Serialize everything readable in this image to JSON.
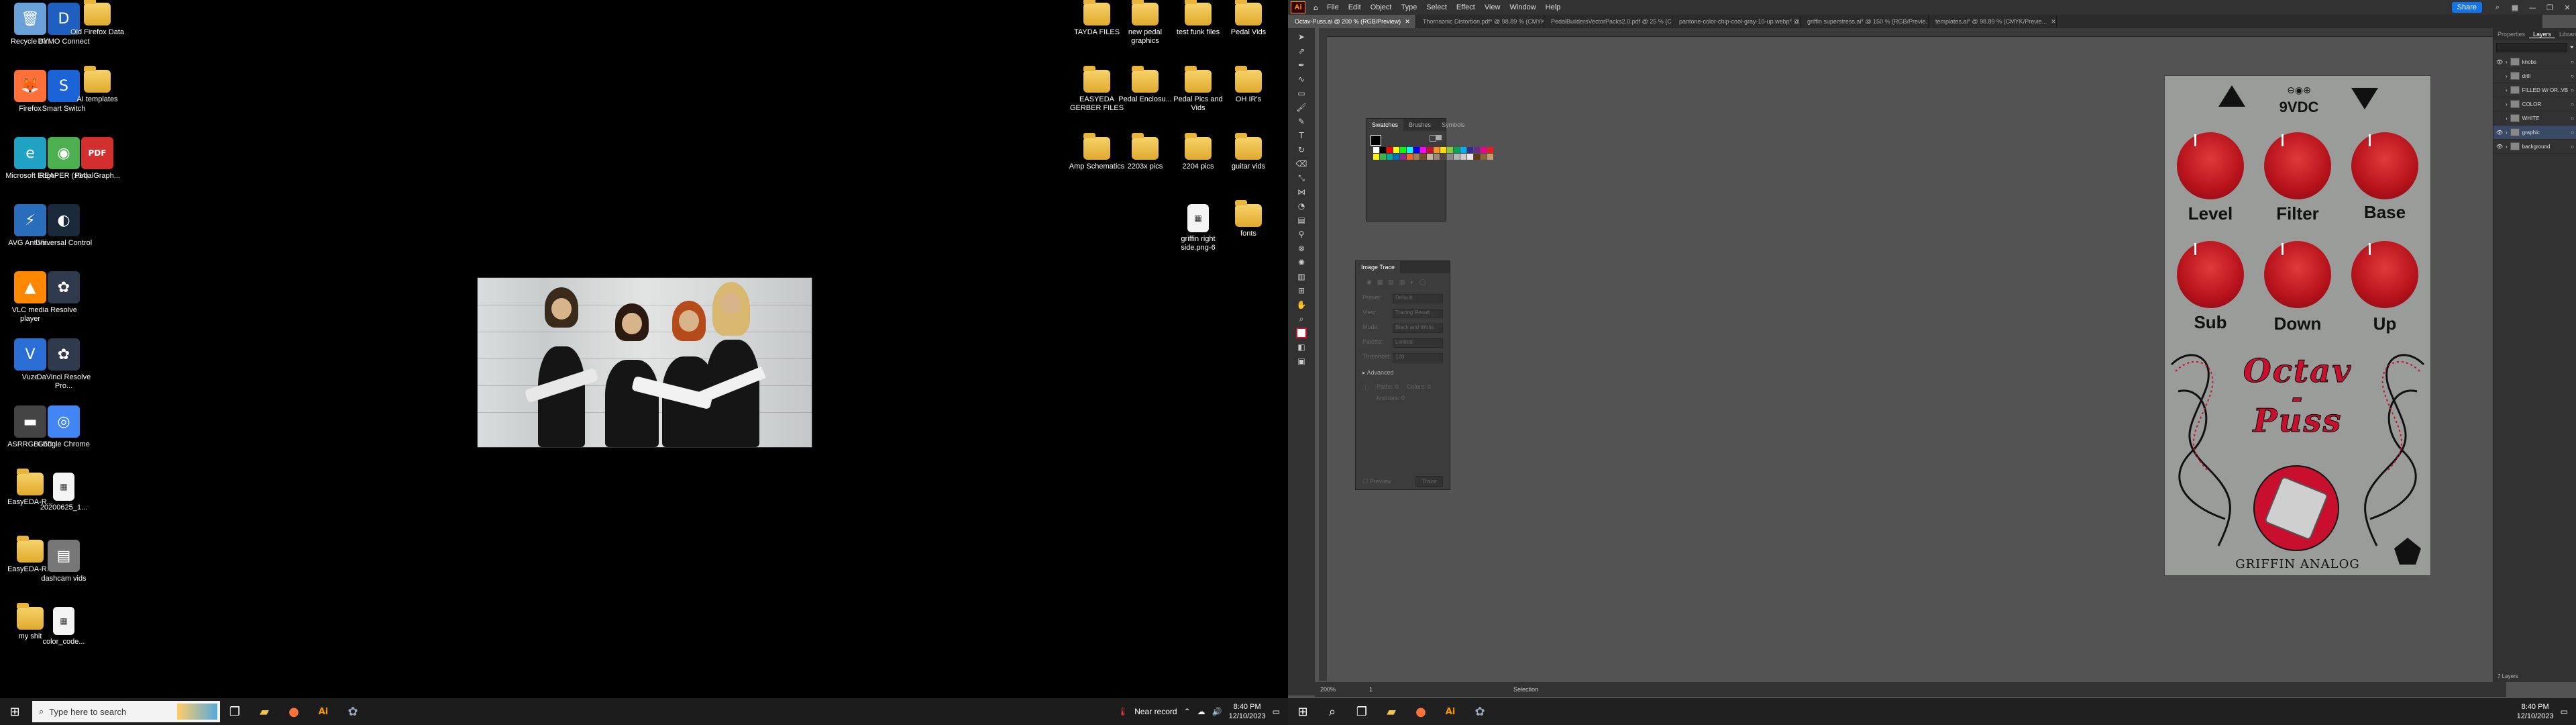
{
  "desktop": {
    "icons_col1": [
      {
        "label": "Recycle Bin",
        "icon": "recycle-bin-icon",
        "color": "#6aa0d8",
        "glyph": "🗑"
      },
      {
        "label": "Firefox",
        "icon": "firefox-icon",
        "color": "#ff7139",
        "glyph": "🦊"
      },
      {
        "label": "Microsoft Edge",
        "icon": "edge-icon",
        "color": "#1fa2c4",
        "glyph": "e"
      },
      {
        "label": "AVG AntiVir...",
        "icon": "avg-icon",
        "color": "#2a6ebb",
        "glyph": "⚡"
      },
      {
        "label": "VLC media player",
        "icon": "vlc-icon",
        "color": "#ff8800",
        "glyph": "▲"
      },
      {
        "label": "Vuze",
        "icon": "vuze-icon",
        "color": "#2b6fd6",
        "glyph": "V"
      },
      {
        "label": "ASRRGBLED",
        "icon": "asrrgb-icon",
        "color": "#444444",
        "glyph": "▬"
      },
      {
        "label": "EasyEDA-R...",
        "icon": "folder-icon",
        "color": "#e0a92d",
        "glyph": ""
      },
      {
        "label": "EasyEDA-R...",
        "icon": "folder-icon",
        "color": "#e0a92d",
        "glyph": ""
      },
      {
        "label": "my shit",
        "icon": "folder-icon",
        "color": "#e0a92d",
        "glyph": ""
      }
    ],
    "icons_col2": [
      {
        "label": "DYMO Connect",
        "icon": "dymo-icon",
        "color": "#1f5fbf",
        "glyph": "D"
      },
      {
        "label": "Smart Switch",
        "icon": "smart-switch-icon",
        "color": "#1b64d8",
        "glyph": "S"
      },
      {
        "label": "REAPER (x64)",
        "icon": "reaper-icon",
        "color": "#4caf50",
        "glyph": "◉"
      },
      {
        "label": "Universal Control",
        "icon": "universal-control-icon",
        "color": "#1a2a3a",
        "glyph": "◐"
      },
      {
        "label": "Resolve",
        "icon": "resolve-icon",
        "color": "#2f3b4c",
        "glyph": "✿"
      },
      {
        "label": "DaVinci Resolve Pro...",
        "icon": "davinci-icon",
        "color": "#2f3b4c",
        "glyph": "✿"
      },
      {
        "label": "Google Chrome",
        "icon": "chrome-icon",
        "color": "#4285f4",
        "glyph": "◎"
      },
      {
        "label": "20200625_1...",
        "icon": "image-file-icon",
        "color": "#555555",
        "glyph": "▦"
      },
      {
        "label": "dashcam vids",
        "icon": "video-folder-icon",
        "color": "#777777",
        "glyph": "▤"
      },
      {
        "label": "color_code...",
        "icon": "doc-file-icon",
        "color": "#f4f4f4",
        "glyph": "▥"
      }
    ],
    "icons_col3": [
      {
        "label": "Old Firefox Data",
        "icon": "folder-icon",
        "color": "#e0a92d",
        "glyph": ""
      },
      {
        "label": "AI templates",
        "icon": "ai-folder-icon",
        "color": "#e0a92d",
        "glyph": ""
      },
      {
        "label": "PedalGraph...",
        "icon": "pdf-icon",
        "color": "#d32f2f",
        "glyph": "PDF"
      }
    ],
    "icons_right_col1": [
      {
        "label": "TAYDA FILES",
        "icon": "folder-icon"
      },
      {
        "label": "EASYEDA GERBER FILES",
        "icon": "folder-icon"
      },
      {
        "label": "Amp Schematics",
        "icon": "folder-icon"
      }
    ],
    "icons_right_col2": [
      {
        "label": "new pedal graphics",
        "icon": "folder-icon"
      },
      {
        "label": "Pedal Enclosu...",
        "icon": "folder-icon"
      },
      {
        "label": "2203x pics",
        "icon": "folder-icon"
      }
    ],
    "icons_right_col3": [
      {
        "label": "test funk files",
        "icon": "folder-icon"
      },
      {
        "label": "Pedal Pics and Vids",
        "icon": "folder-icon"
      },
      {
        "label": "2204 pics",
        "icon": "folder-icon"
      },
      {
        "label": "griffin right side.png-6",
        "icon": "image-file-icon"
      }
    ],
    "icons_right_col4": [
      {
        "label": "Pedal Vids",
        "icon": "folder-icon"
      },
      {
        "label": "OH IR's",
        "icon": "folder-icon"
      },
      {
        "label": "guitar vids",
        "icon": "folder-icon"
      },
      {
        "label": "fonts",
        "icon": "folder-icon"
      }
    ]
  },
  "taskbar_left": {
    "search_placeholder": "Type here to search",
    "weather": "Near record",
    "time": "8:40 PM",
    "date": "12/10/2023"
  },
  "taskbar_right": {
    "time": "8:40 PM",
    "date": "12/10/2023"
  },
  "illustrator": {
    "menu": [
      "File",
      "Edit",
      "Object",
      "Type",
      "Select",
      "Effect",
      "View",
      "Window",
      "Help"
    ],
    "share_label": "Share",
    "tabs": [
      "Octav-Puss.ai @ 200 % (RGB/Preview)",
      "Thornsonic Distortion.pdf* @ 98.89 % (CMYK/Pr...",
      "PedalBuildersVectorPacks2.0.pdf @ 25 % (CMYK...",
      "pantone-color-chip-cool-gray-10-up.webp* @ 8...",
      "griffin superstress.ai* @ 150 % (RGB/Previe...",
      "templates.ai* @ 98.89 % (CMYK/Previe..."
    ],
    "swatches_panel": {
      "tabs": [
        "Swatches",
        "Brushes",
        "Symbols"
      ],
      "colors": [
        "#ffffff",
        "#000000",
        "#ff0000",
        "#ffff00",
        "#00ff00",
        "#00ffff",
        "#0000ff",
        "#ff00ff",
        "#c8102e",
        "#f7941d",
        "#ffde00",
        "#8dc63f",
        "#00a651",
        "#00aeef",
        "#2e3192",
        "#662d91",
        "#ec008c",
        "#ed1c24",
        "#fff200",
        "#39b54a",
        "#00a99d",
        "#0072bc",
        "#92278f",
        "#f26522",
        "#a67c52",
        "#754c24",
        "#c7b299",
        "#998675",
        "#534741",
        "#898989",
        "#b3b3b3",
        "#cccccc",
        "#e6e6e6",
        "#603913",
        "#8c6239",
        "#c69c6d"
      ]
    },
    "image_trace_panel": {
      "title": "Image Trace",
      "rows": [
        {
          "label": "Preset:",
          "value": "Default"
        },
        {
          "label": "View:",
          "value": "Tracing Result"
        },
        {
          "label": "Mode:",
          "value": "Black and White"
        },
        {
          "label": "Palette:",
          "value": "Limited"
        },
        {
          "label": "Threshold:",
          "value": "128"
        }
      ],
      "advanced_label": "Advanced",
      "paths_label": "Paths: 0",
      "anchors_label": "Anchors: 0",
      "colors_label": "Colors: 0",
      "preview_label": "Preview",
      "trace_button": "Trace"
    },
    "right_tabs": [
      "Properties",
      "Layers",
      "Libraries"
    ],
    "layers": [
      "knobs",
      "drill",
      "FILLED W/ OR..VB",
      "COLOR",
      "WHITE",
      "graphic",
      "background"
    ],
    "layers_count": "7 Layers",
    "zoom": "200%",
    "page": "1",
    "status_tool": "Selection"
  },
  "pedal": {
    "voltage_label": "9VDC",
    "knobs_row1": [
      "Level",
      "Filter",
      "Base"
    ],
    "knobs_row2": [
      "Sub",
      "Down",
      "Up"
    ],
    "title_line1": "Octav",
    "title_dash": "-",
    "title_line2": "Puss",
    "brand": "GRIFFIN ANALOG",
    "body_color": "#9a9c9a",
    "knob_color": "#c8102e"
  }
}
